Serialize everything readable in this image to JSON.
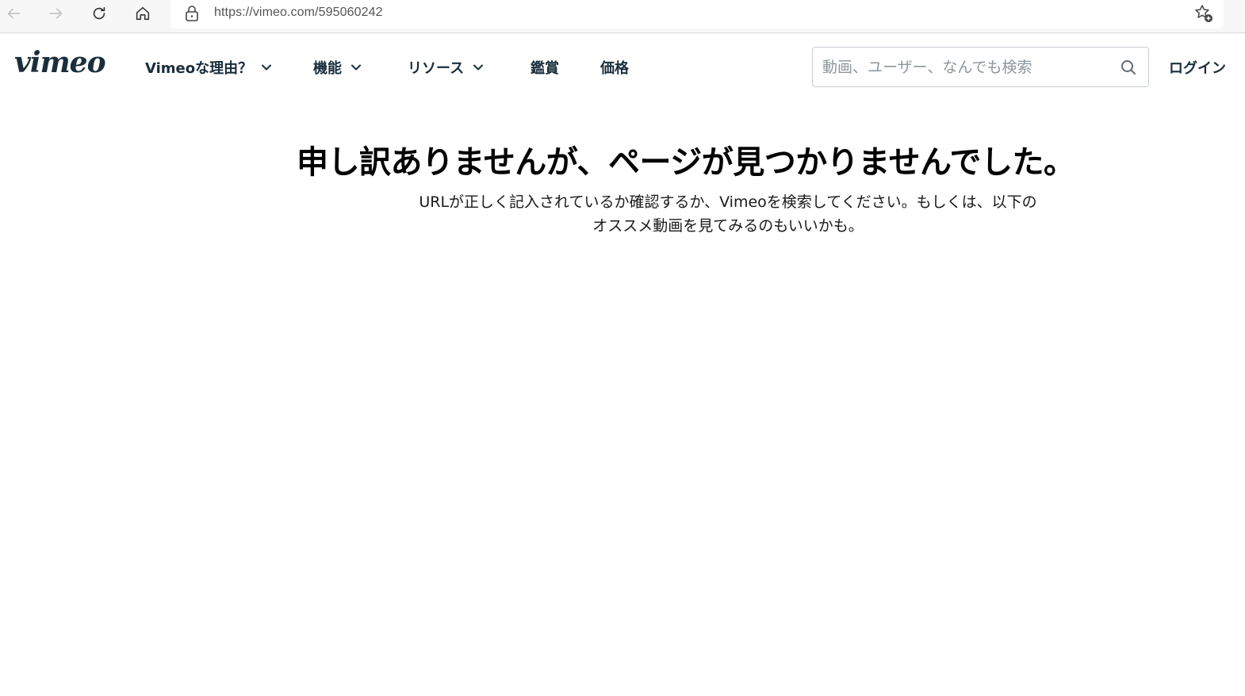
{
  "browser": {
    "url": "https://vimeo.com/595060242"
  },
  "header": {
    "logo_text": "vimeo",
    "nav": [
      {
        "label": "Vimeoな理由？",
        "has_dropdown": true
      },
      {
        "label": "機能",
        "has_dropdown": true
      },
      {
        "label": "リソース",
        "has_dropdown": true
      },
      {
        "label": "鑑賞",
        "has_dropdown": false
      },
      {
        "label": "価格",
        "has_dropdown": false
      }
    ],
    "search": {
      "placeholder": "動画、ユーザー、なんでも検索",
      "value": ""
    },
    "login_label": "ログイン"
  },
  "main": {
    "title": "申し訳ありませんが、ページが見つかりませんでした。",
    "description": "URLが正しく記入されているか確認するか、Vimeoを検索してください。もしくは、以下のオススメ動画を見てみるのもいいかも。"
  },
  "colors": {
    "text_dark": "#1a2e3b",
    "heading": "#000000",
    "chrome_bg": "#f7f7f7"
  }
}
